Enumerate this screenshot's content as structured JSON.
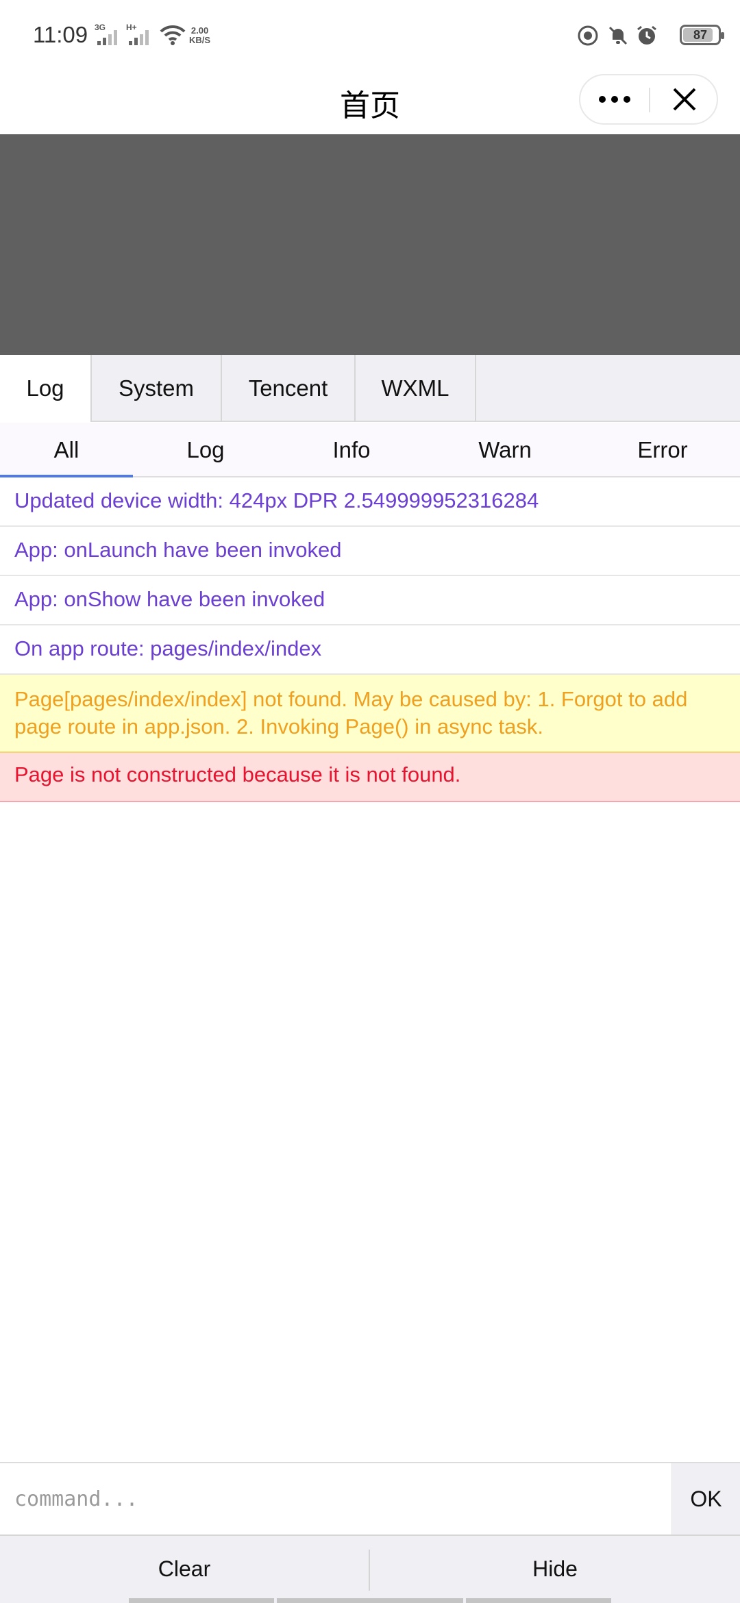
{
  "status_bar": {
    "time": "11:09",
    "signal1_label": "3G",
    "signal2_label": "H+",
    "net_speed_value": "2.00",
    "net_speed_unit": "KB/S",
    "battery_level": "87",
    "battery_fraction": 0.87,
    "icons": [
      "signal-icon",
      "wifi-icon",
      "vpn-icon",
      "mute-icon",
      "alarm-icon",
      "battery-icon"
    ]
  },
  "nav_bar": {
    "title": "首页"
  },
  "main_tabs": [
    {
      "label": "Log",
      "active": true
    },
    {
      "label": "System",
      "active": false
    },
    {
      "label": "Tencent",
      "active": false
    },
    {
      "label": "WXML",
      "active": false
    }
  ],
  "filter_tabs": [
    {
      "label": "All",
      "active": true
    },
    {
      "label": "Log",
      "active": false
    },
    {
      "label": "Info",
      "active": false
    },
    {
      "label": "Warn",
      "active": false
    },
    {
      "label": "Error",
      "active": false
    }
  ],
  "logs": [
    {
      "level": "info",
      "text": "Updated device width: 424px DPR 2.549999952316284"
    },
    {
      "level": "info",
      "text": "App: onLaunch have been invoked"
    },
    {
      "level": "info",
      "text": "App: onShow have been invoked"
    },
    {
      "level": "info",
      "text": "On app route: pages/index/index"
    },
    {
      "level": "warn",
      "text": "Page[pages/index/index] not found. May be caused by: 1. Forgot to add page route in app.json. 2. Invoking Page() in async task."
    },
    {
      "level": "error",
      "text": "Page is not constructed because it is not found."
    }
  ],
  "command": {
    "placeholder": "command...",
    "value": "",
    "ok_label": "OK"
  },
  "toolbar": {
    "clear_label": "Clear",
    "hide_label": "Hide"
  },
  "colors": {
    "info_text": "#6a3fd1",
    "warn_text": "#f0a020",
    "warn_bg": "#ffffcc",
    "error_text": "#e8132f",
    "error_bg": "#ffdede",
    "mask": "#606060",
    "accent": "#4f7ae6"
  }
}
